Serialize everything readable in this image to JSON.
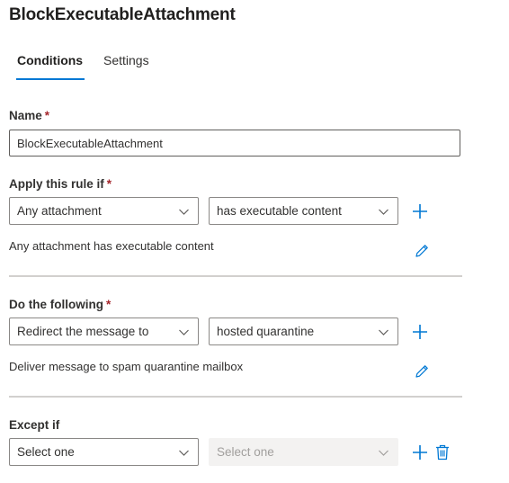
{
  "page": {
    "title": "BlockExecutableAttachment"
  },
  "tabs": [
    {
      "label": "Conditions",
      "selected": true
    },
    {
      "label": "Settings",
      "selected": false
    }
  ],
  "name_field": {
    "label": "Name",
    "required_marker": "*",
    "value": "BlockExecutableAttachment"
  },
  "apply_rule": {
    "label": "Apply this rule if",
    "required_marker": "*",
    "condition_dropdown": "Any attachment",
    "value_dropdown": "has executable content",
    "summary": "Any attachment has executable content"
  },
  "do_following": {
    "label": "Do the following",
    "required_marker": "*",
    "action_dropdown": "Redirect the message to",
    "value_dropdown": "hosted quarantine",
    "summary": "Deliver message to spam quarantine mailbox"
  },
  "except_if": {
    "label": "Except if",
    "condition_dropdown": "Select one",
    "value_dropdown": "Select one",
    "value_dropdown_disabled": true
  },
  "colors": {
    "accent": "#0078d4",
    "required": "#a4262c",
    "divider": "#d2d0ce",
    "disabled_bg": "#f3f2f1",
    "disabled_text": "#a19f9d"
  },
  "icons": {
    "add": "add-icon",
    "edit": "edit-pencil-icon",
    "delete": "delete-trash-icon",
    "chevron": "chevron-down-icon"
  }
}
